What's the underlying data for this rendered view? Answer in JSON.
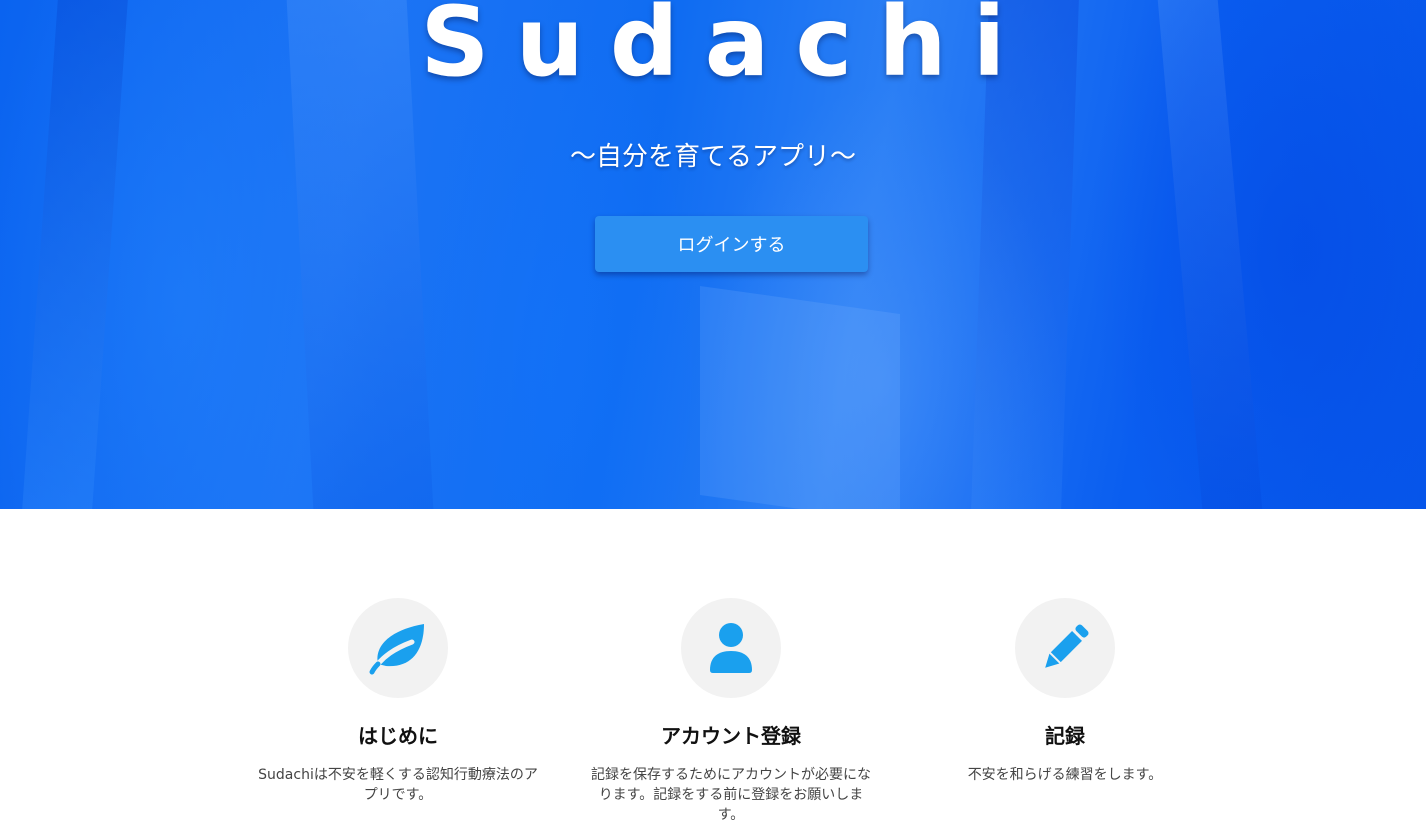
{
  "hero": {
    "title": "Sudachi",
    "subtitle": "〜自分を育てるアプリ〜",
    "login_button": "ログインする"
  },
  "features": [
    {
      "icon": "leaf-icon",
      "title": "はじめに",
      "text": "Sudachiは不安を軽くする認知行動療法のアプリです。"
    },
    {
      "icon": "user-icon",
      "title": "アカウント登録",
      "text": "記録を保存するためにアカウントが必要になります。記録をする前に登録をお願いします。"
    },
    {
      "icon": "pencil-icon",
      "title": "記録",
      "text": "不安を和らげる練習をします。"
    }
  ],
  "colors": {
    "hero_blue": "#0a63f0",
    "button_blue": "#2b8ff2",
    "icon_blue": "#1aa0ee",
    "icon_circle_bg": "#f2f2f2"
  }
}
